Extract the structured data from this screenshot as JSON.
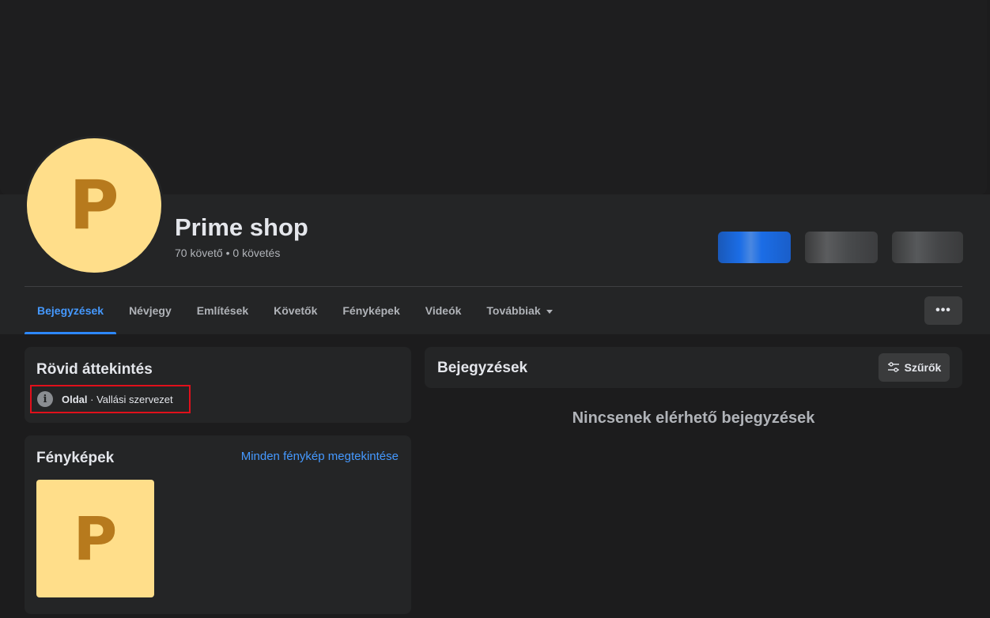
{
  "profile": {
    "avatar_letter": "P",
    "name": "Prime shop",
    "stats": "70 követő • 0 követés"
  },
  "tabs": [
    {
      "label": "Bejegyzések",
      "active": true
    },
    {
      "label": "Névjegy"
    },
    {
      "label": "Említések"
    },
    {
      "label": "Követők"
    },
    {
      "label": "Fényképek"
    },
    {
      "label": "Videók"
    },
    {
      "label": "Továbbiak"
    }
  ],
  "more_button": "•••",
  "intro": {
    "title": "Rövid áttekintés",
    "info_icon": "i",
    "category_type": "Oldal",
    "category_value": " · Vallási szervezet"
  },
  "photos": {
    "title": "Fényképek",
    "see_all": "Minden fénykép megtekintése",
    "thumb_letter": "P"
  },
  "posts": {
    "title": "Bejegyzések",
    "filter_label": "Szűrők",
    "empty_message": "Nincsenek elérhető bejegyzések"
  },
  "colors": {
    "accent": "#2d88ff",
    "avatar_bg": "#ffde8a",
    "avatar_letter": "#b77a1d",
    "highlight_border": "#e0101b"
  }
}
